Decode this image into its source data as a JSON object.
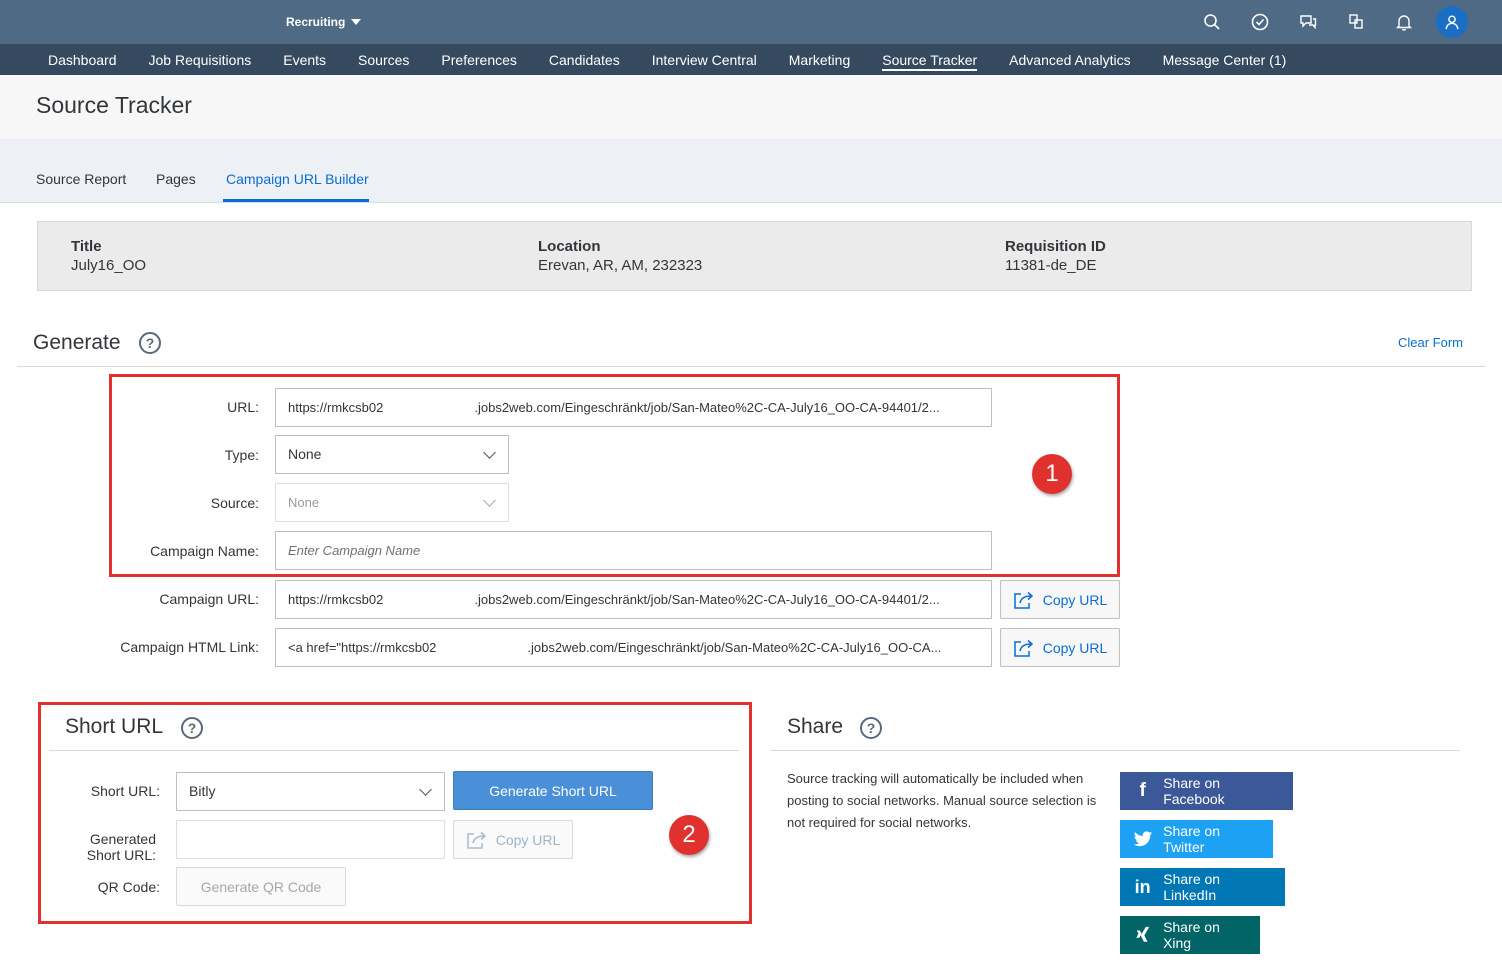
{
  "shell": {
    "app_menu": "Recruiting",
    "icons": [
      "search-icon",
      "check-circle-icon",
      "feedback-icon",
      "product-switch-icon",
      "bell-icon",
      "user-avatar-icon"
    ]
  },
  "topnav": {
    "items": [
      "Dashboard",
      "Job Requisitions",
      "Events",
      "Sources",
      "Preferences",
      "Candidates",
      "Interview Central",
      "Marketing",
      "Source Tracker",
      "Advanced Analytics",
      "Message Center (1)"
    ],
    "active": "Source Tracker"
  },
  "page": {
    "title": "Source Tracker"
  },
  "subtabs": {
    "items": [
      "Source Report",
      "Pages",
      "Campaign URL Builder"
    ],
    "active": "Campaign URL Builder"
  },
  "info": {
    "title_label": "Title",
    "title_value": "July16_OO",
    "location_label": "Location",
    "location_value": "Erevan, AR, AM, 232323",
    "req_label": "Requisition ID",
    "req_value": "11381-de_DE"
  },
  "generate": {
    "title": "Generate",
    "help": "?",
    "clear_form": "Clear Form",
    "url_label": "URL:",
    "url_value": "https://rmkcsb02       .jobs2web.com/Eingeschränkt/job/San-Mateo%2C-CA-July16_OO-CA-94401/2...",
    "type_label": "Type:",
    "type_value": "None",
    "source_label": "Source:",
    "source_value": "None",
    "campaign_name_label": "Campaign Name:",
    "campaign_name_placeholder": "Enter Campaign Name",
    "campaign_url_label": "Campaign URL:",
    "campaign_url_value": "https://rmkcsb02       .jobs2web.com/Eingeschränkt/job/San-Mateo%2C-CA-July16_OO-CA-94401/2...",
    "campaign_html_label": "Campaign HTML Link:",
    "campaign_html_value": "<a href=\"https://rmkcsb02       .jobs2web.com/Eingeschränkt/job/San-Mateo%2C-CA-July16_OO-CA...",
    "copy_url": "Copy URL",
    "annotation": "1"
  },
  "short_url": {
    "title": "Short URL",
    "help": "?",
    "short_url_label": "Short URL:",
    "short_url_value": "Bitly",
    "generate_button": "Generate Short URL",
    "generated_label_1": "Generated",
    "generated_label_2": "Short URL:",
    "copy_url": "Copy URL",
    "qr_label": "QR Code:",
    "qr_button": "Generate QR Code",
    "annotation": "2"
  },
  "share": {
    "title": "Share",
    "help": "?",
    "text": "Source tracking will automatically be included when posting to social networks. Manual source selection is not required for social networks.",
    "facebook": "Share on Facebook",
    "twitter": "Share on Twitter",
    "linkedin": "Share on LinkedIn",
    "xing": "Share on Xing",
    "colors": {
      "facebook": "#3b5998",
      "twitter": "#1da1f2",
      "linkedin": "#0077b5",
      "xing": "#026466"
    }
  }
}
